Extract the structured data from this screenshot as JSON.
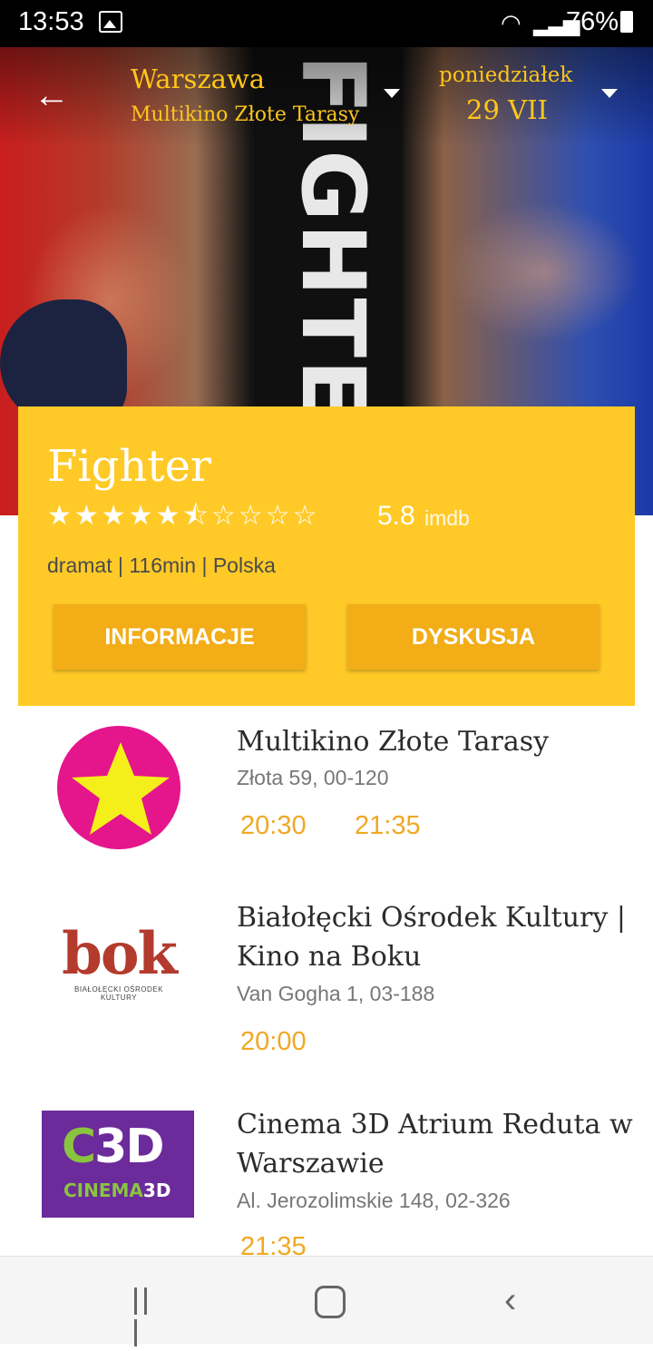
{
  "status_bar": {
    "time": "13:53",
    "battery": "76%"
  },
  "header": {
    "city": "Warszawa",
    "cinema": "Multikino Złote Tarasy",
    "day": "poniedziałek",
    "date": "29 VII"
  },
  "movie": {
    "title": "Fighter",
    "stars": "★★★★★⯪☆☆☆☆",
    "rating": "5.8",
    "rating_source": "imdb",
    "meta": "dramat | 116min | Polska",
    "info_button": "INFORMACJE",
    "discussion_button": "DYSKUSJA"
  },
  "cinemas": [
    {
      "name": "Multikino Złote Tarasy",
      "address": "Złota 59, 00-120",
      "times": [
        "20:30",
        "21:35"
      ]
    },
    {
      "name": "Białołęcki Ośrodek Kultury | Kino na Boku",
      "address": "Van Gogha 1, 03-188",
      "times": [
        "20:00"
      ]
    },
    {
      "name": "Cinema 3D Atrium Reduta w Warszawie",
      "address": "Al. Jerozolimskie 148, 02-326",
      "times": [
        "21:35"
      ]
    }
  ],
  "logos": {
    "bok": "bok",
    "bok_sub": "BIAŁOŁĘCKI OŚRODEK KULTURY",
    "c3d": "C3D",
    "c3d_sub": "CINEMA3D"
  },
  "poster_text": "FIGHTE",
  "colors": {
    "accent": "#ffca28",
    "button": "#f2ad17",
    "showtime": "#f0a824",
    "header_text": "#ffc61a"
  }
}
